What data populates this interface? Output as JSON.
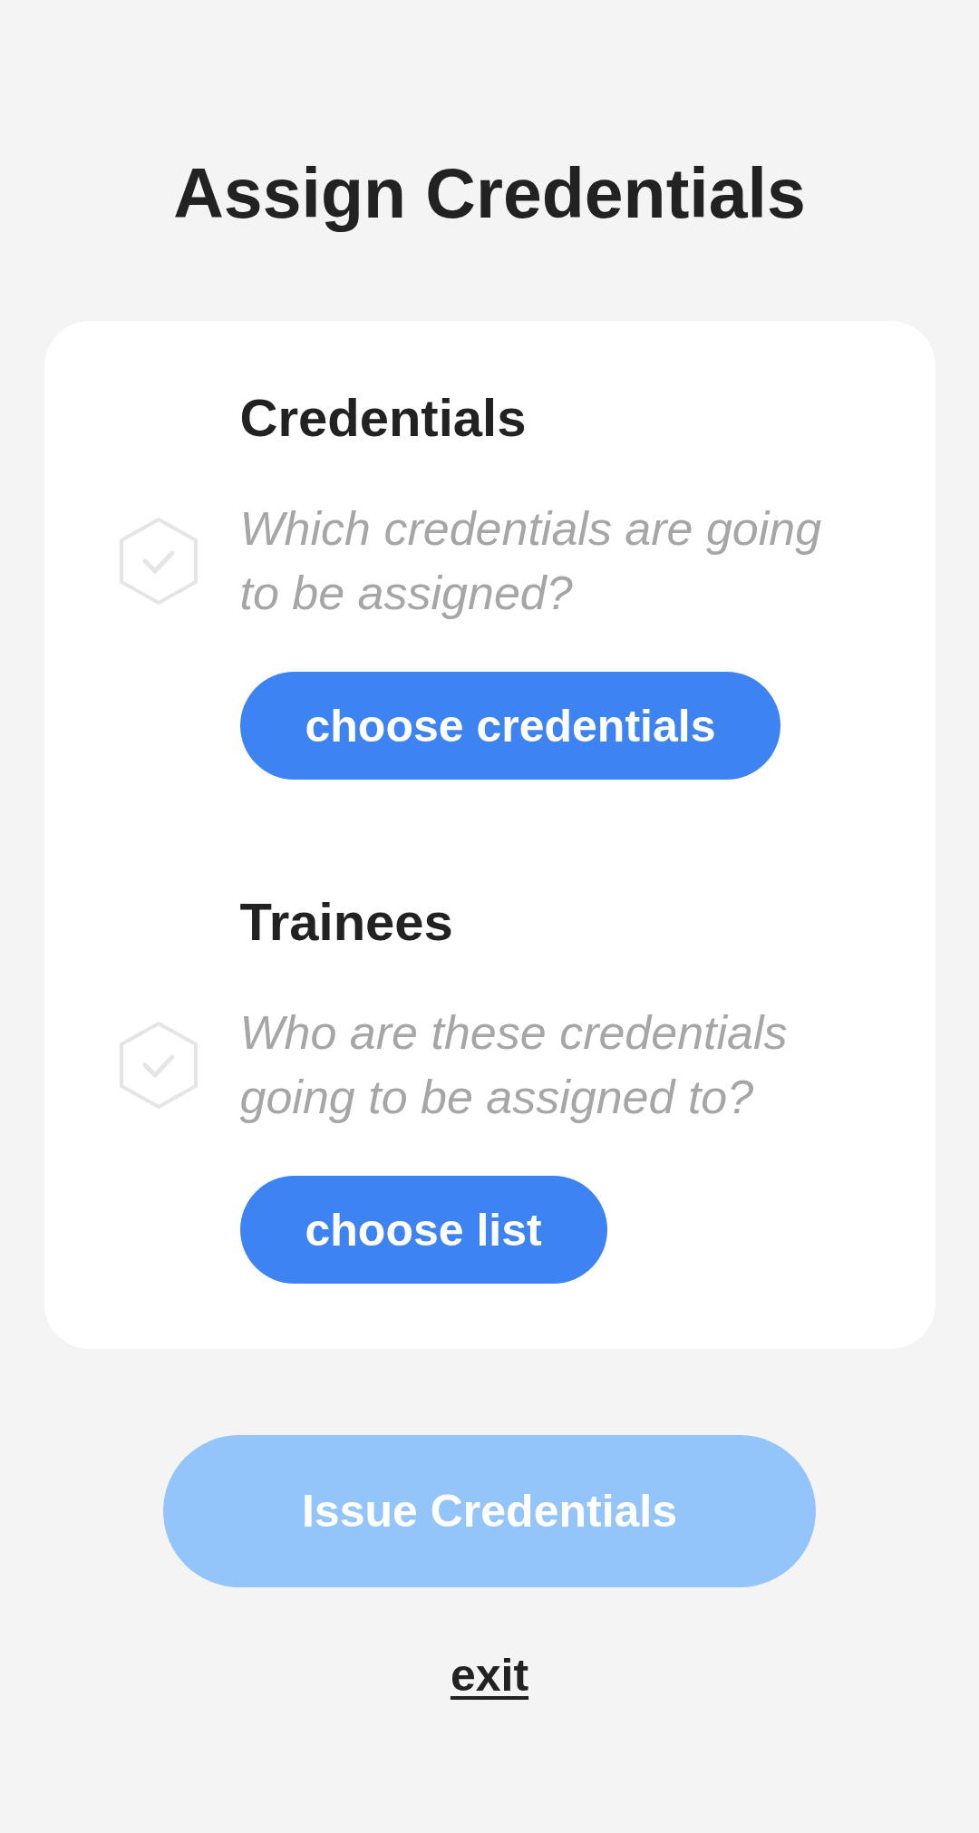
{
  "title": "Assign Credentials",
  "sections": [
    {
      "heading": "Credentials",
      "prompt": "Which credentials are going to be assigned?",
      "button": "choose credentials",
      "completed": false
    },
    {
      "heading": "Trainees",
      "prompt": "Who are these credentials going to be assigned to?",
      "button": "choose list",
      "completed": false
    }
  ],
  "issue_button": {
    "label": "Issue Credentials",
    "disabled": true
  },
  "exit_link": {
    "label": "exit"
  }
}
